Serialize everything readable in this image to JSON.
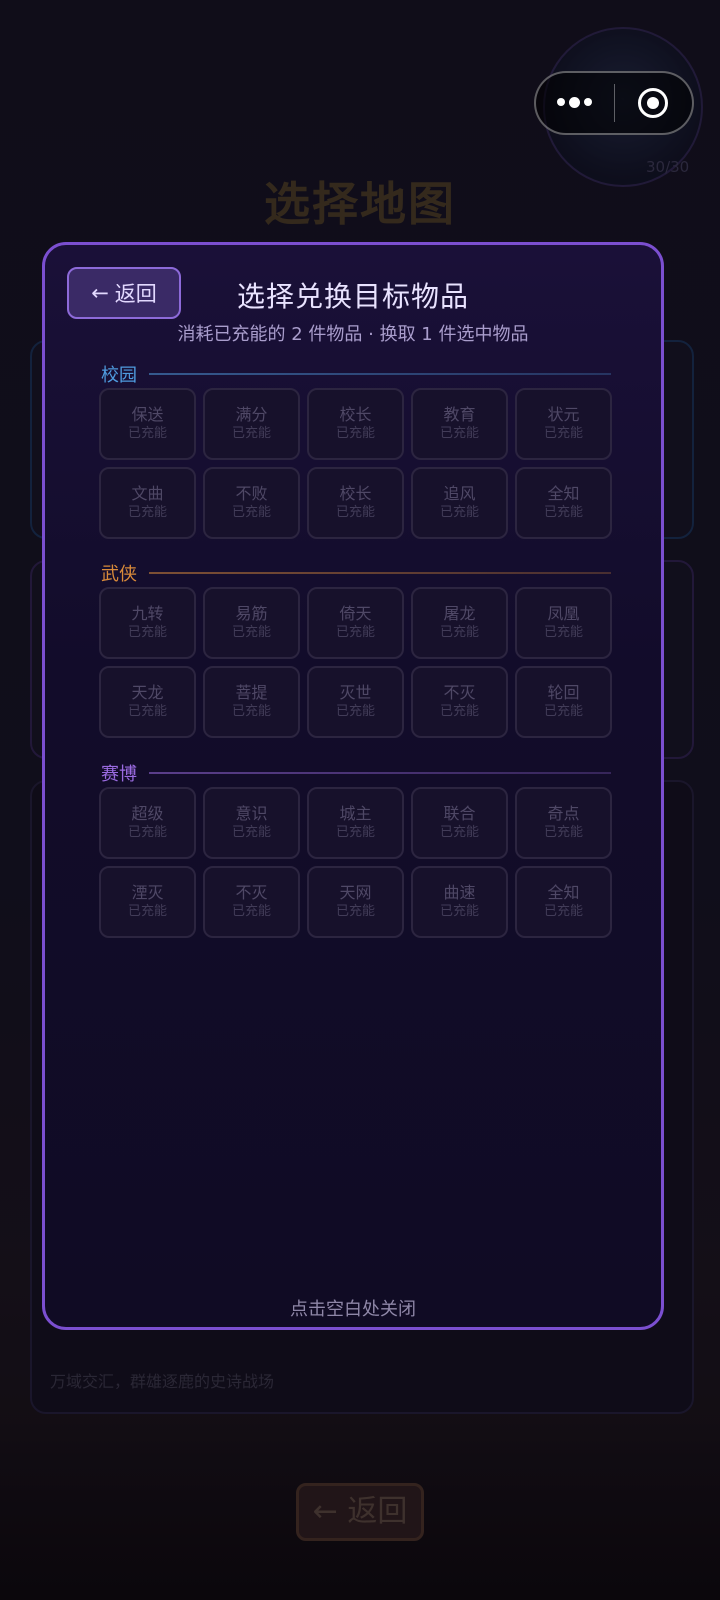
{
  "background": {
    "title": "选择地图",
    "energy": "30/30",
    "caption": "万域交汇，群雄逐鹿的史诗战场",
    "back_label": "← 返回"
  },
  "capsule": {
    "more_icon": "more-dots-icon",
    "close_icon": "target-icon"
  },
  "modal": {
    "back_label": "返回",
    "title": "选择兑换目标物品",
    "subtitle": "消耗已充能的 2 件物品 · 换取 1 件选中物品",
    "close_hint": "点击空白处关闭",
    "sections": [
      {
        "label": "校园",
        "color": "#4f9bde",
        "items": [
          {
            "name": "保送",
            "status": "已充能"
          },
          {
            "name": "满分",
            "status": "已充能"
          },
          {
            "name": "校长",
            "status": "已充能"
          },
          {
            "name": "教育",
            "status": "已充能"
          },
          {
            "name": "状元",
            "status": "已充能"
          },
          {
            "name": "文曲",
            "status": "已充能"
          },
          {
            "name": "不败",
            "status": "已充能"
          },
          {
            "name": "校长",
            "status": "已充能"
          },
          {
            "name": "追风",
            "status": "已充能"
          },
          {
            "name": "全知",
            "status": "已充能"
          }
        ]
      },
      {
        "label": "武侠",
        "color": "#d98a3a",
        "items": [
          {
            "name": "九转",
            "status": "已充能"
          },
          {
            "name": "易筋",
            "status": "已充能"
          },
          {
            "name": "倚天",
            "status": "已充能"
          },
          {
            "name": "屠龙",
            "status": "已充能"
          },
          {
            "name": "凤凰",
            "status": "已充能"
          },
          {
            "name": "天龙",
            "status": "已充能"
          },
          {
            "name": "菩提",
            "status": "已充能"
          },
          {
            "name": "灭世",
            "status": "已充能"
          },
          {
            "name": "不灭",
            "status": "已充能"
          },
          {
            "name": "轮回",
            "status": "已充能"
          }
        ]
      },
      {
        "label": "赛博",
        "color": "#9a6be0",
        "items": [
          {
            "name": "超级",
            "status": "已充能"
          },
          {
            "name": "意识",
            "status": "已充能"
          },
          {
            "name": "城主",
            "status": "已充能"
          },
          {
            "name": "联合",
            "status": "已充能"
          },
          {
            "name": "奇点",
            "status": "已充能"
          },
          {
            "name": "湮灭",
            "status": "已充能"
          },
          {
            "name": "不灭",
            "status": "已充能"
          },
          {
            "name": "天网",
            "status": "已充能"
          },
          {
            "name": "曲速",
            "status": "已充能"
          },
          {
            "name": "全知",
            "status": "已充能"
          }
        ]
      }
    ]
  }
}
